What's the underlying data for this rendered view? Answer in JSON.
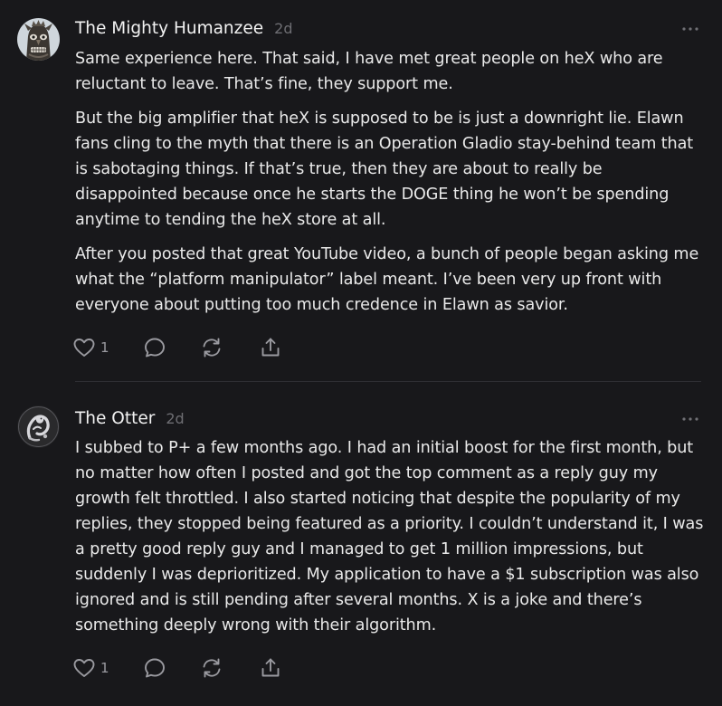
{
  "comments": [
    {
      "author": "The Mighty Humanzee",
      "time": "2d",
      "avatar_icon": "tiki-mask-avatar",
      "paragraphs": [
        "Same experience here. That said, I have met great people on heX who are reluctant to leave. That’s fine, they support me.",
        "But the big amplifier that heX is supposed to be is just a downright lie. Elawn fans cling to the myth that there is an Operation Gladio stay-behind team that is sabotaging things. If that’s true, then they are about to really be disappointed because once he starts the DOGE thing he won’t be spending anytime to tending the heX store at all.",
        "After you posted that great YouTube video, a bunch of people began asking me what the “platform manipulator” label meant. I’ve been very up front with everyone about putting too much credence in Elawn as savior."
      ],
      "likes": "1"
    },
    {
      "author": "The Otter",
      "time": "2d",
      "avatar_icon": "otter-avatar",
      "paragraphs": [
        "I subbed to P+ a few months ago. I had an initial boost for the first month, but no matter how often I posted and got the top comment as a reply guy my growth felt throttled. I also started noticing that despite the popularity of my replies, they stopped being featured as a priority. I couldn’t understand it, I was a pretty good reply guy and I managed to get 1 million impressions, but suddenly I was deprioritized. My application to have a $1 subscription was also ignored and is still pending after several months. X is a joke and there’s something deeply wrong with their algorithm."
      ],
      "likes": "1"
    }
  ],
  "icons": {
    "more": "ellipsis-icon",
    "like": "heart-icon",
    "reply": "speech-bubble-icon",
    "restack": "restack-arrows-icon",
    "share": "share-icon"
  },
  "colors": {
    "background": "#18181b",
    "text": "#e9e9e9",
    "muted": "#6e6e73",
    "icon": "#9a9aa0",
    "divider": "#2e2e33"
  }
}
